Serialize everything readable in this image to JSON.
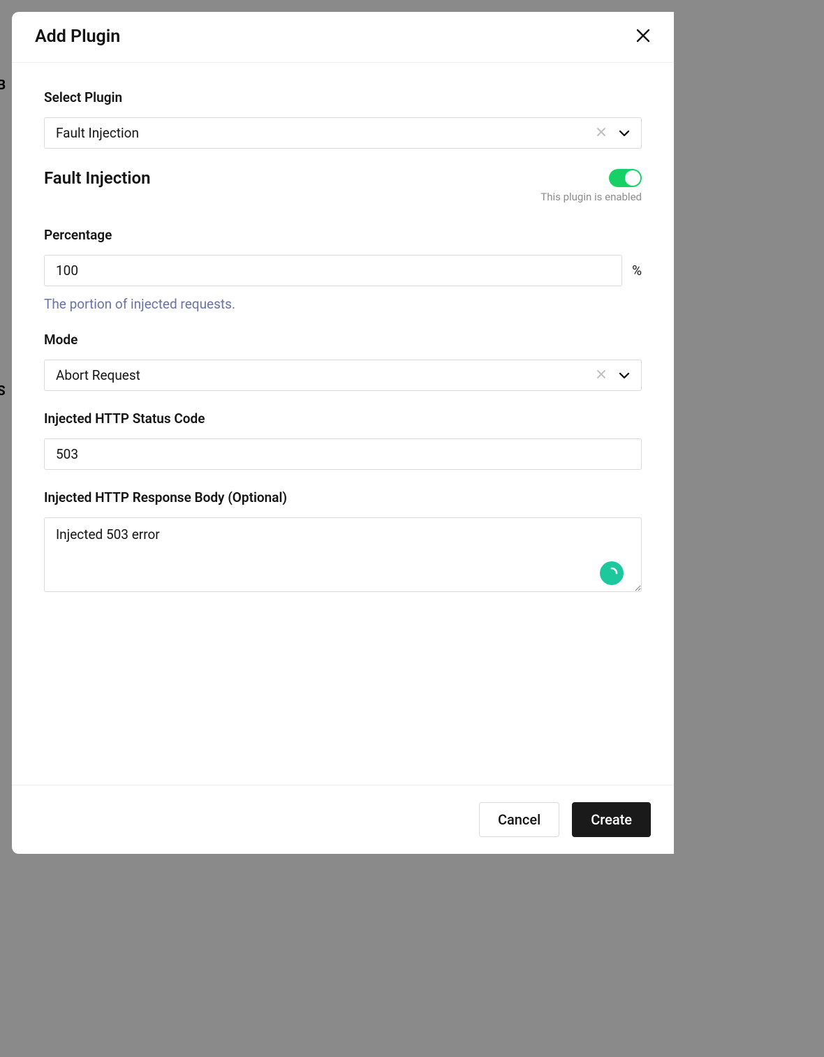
{
  "modal": {
    "title": "Add Plugin",
    "footer": {
      "cancel": "Cancel",
      "create": "Create"
    }
  },
  "form": {
    "selectPlugin": {
      "label": "Select Plugin",
      "value": "Fault Injection"
    },
    "pluginSection": {
      "title": "Fault Injection",
      "enabled": true,
      "enabledHint": "This plugin is enabled"
    },
    "percentage": {
      "label": "Percentage",
      "value": "100",
      "suffix": "%",
      "help": "The portion of injected requests."
    },
    "mode": {
      "label": "Mode",
      "value": "Abort Request"
    },
    "statusCode": {
      "label": "Injected HTTP Status Code",
      "value": "503"
    },
    "responseBody": {
      "label": "Injected HTTP Response Body (Optional)",
      "value": "Injected 503 error"
    }
  },
  "backdrop": {
    "t1": "B",
    "t2": "S"
  }
}
